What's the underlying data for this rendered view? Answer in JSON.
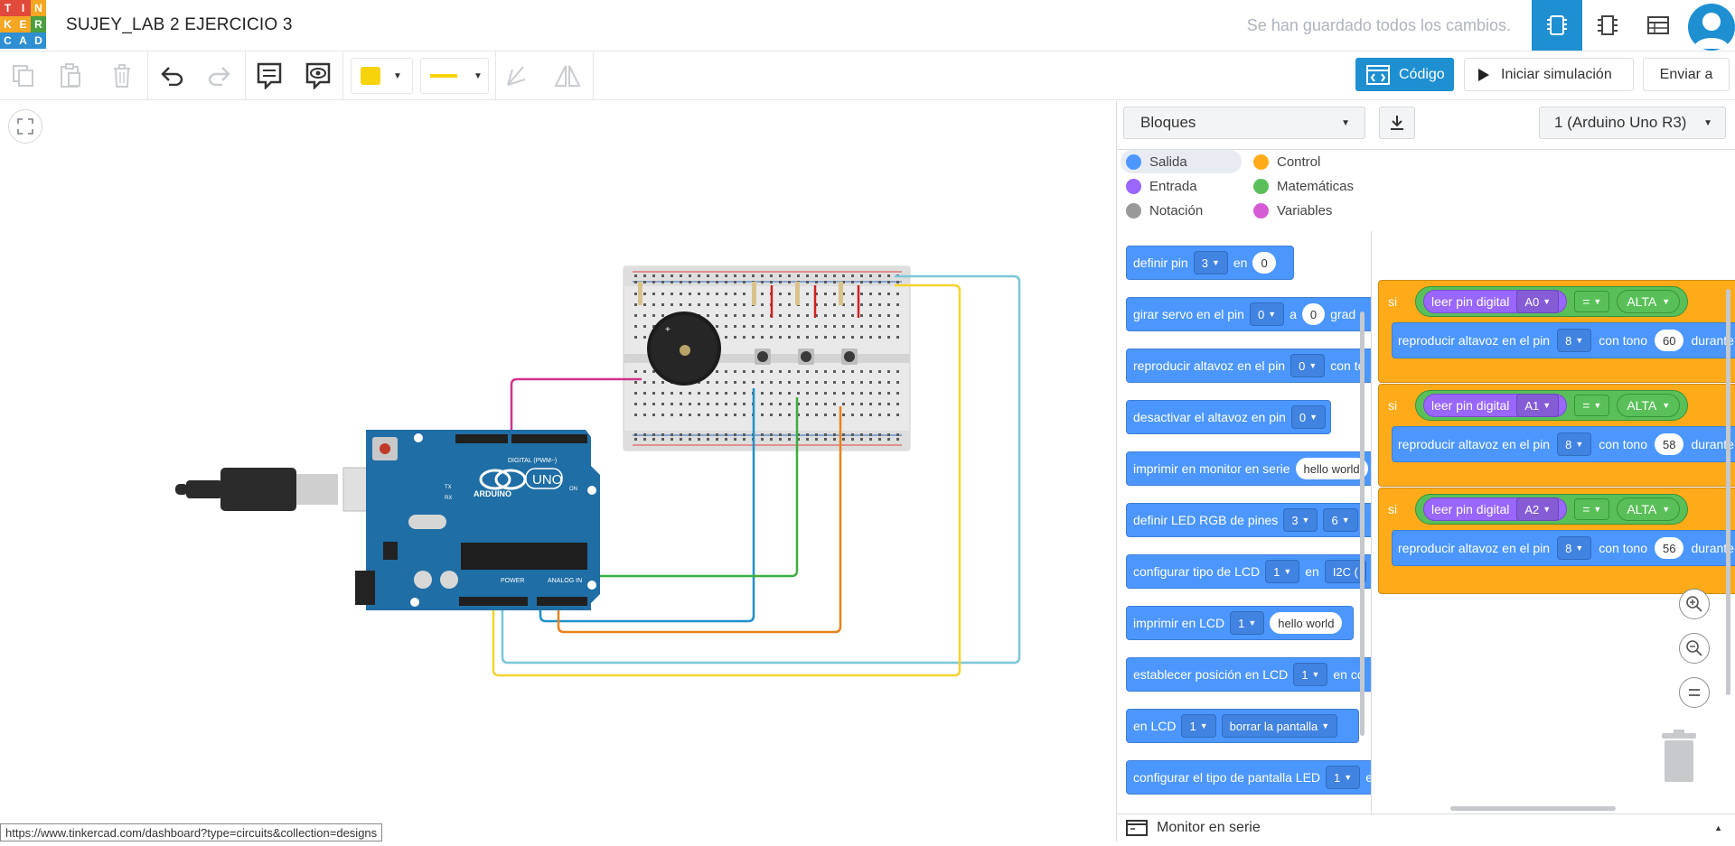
{
  "header": {
    "logo_letters": [
      "T",
      "I",
      "N",
      "K",
      "E",
      "R",
      "C",
      "A",
      "D"
    ],
    "logo_colors": [
      "#e1493b",
      "#e1493b",
      "#f5a623",
      "#f5a623",
      "#f5a623",
      "#4a9f3f",
      "#2e8fd2",
      "#2e8fd2",
      "#2e8fd2"
    ],
    "title": "SUJEY_LAB 2 EJERCICIO 3",
    "save_status": "Se han guardado todos los cambios."
  },
  "toolbar": {
    "code_label": "Código",
    "simulate_label": "Iniciar simulación",
    "send_label": "Enviar a",
    "fill_color": "#f7d40a",
    "line_color": "#f7d40a"
  },
  "status_url": "https://www.tinkercad.com/dashboard?type=circuits&collection=designs",
  "code_panel": {
    "mode": "Bloques",
    "board": "1 (Arduino Uno R3)",
    "categories": [
      {
        "label": "Salida",
        "color": "#4c97ff"
      },
      {
        "label": "Control",
        "color": "#ffab19"
      },
      {
        "label": "Entrada",
        "color": "#9966ff"
      },
      {
        "label": "Matemáticas",
        "color": "#59c059"
      },
      {
        "label": "Notación",
        "color": "#999999"
      },
      {
        "label": "Variables",
        "color": "#d65cd6"
      }
    ],
    "palette": {
      "b1": {
        "text": "definir pin",
        "v1": "3",
        "mid": "en",
        "v2": "0"
      },
      "b2": {
        "text": "girar servo en el pin",
        "v1": "0",
        "mid": "a",
        "v2": "0",
        "tail": "grad"
      },
      "b3": {
        "text": "reproducir altavoz en el pin",
        "v1": "0",
        "tail": "con to"
      },
      "b4": {
        "text": "desactivar el altavoz en pin",
        "v1": "0"
      },
      "b5": {
        "text": "imprimir en monitor en serie",
        "v1": "hello world"
      },
      "b6": {
        "text": "definir LED RGB de pines",
        "v1": "3",
        "v2": "6"
      },
      "b7": {
        "text": "configurar tipo de LCD",
        "v1": "1",
        "mid": "en",
        "v2": "I2C ("
      },
      "b8": {
        "text": "imprimir en LCD",
        "v1": "1",
        "v2": "hello world"
      },
      "b9": {
        "text": "establecer posición en LCD",
        "v1": "1",
        "tail": "en co"
      },
      "b10": {
        "text": "en LCD",
        "v1": "1",
        "v2": "borrar la pantalla"
      },
      "b11": {
        "text": "configurar el tipo de pantalla LED",
        "v1": "1",
        "tail": "e"
      }
    },
    "program": [
      {
        "si": "si",
        "read": "leer pin digital",
        "pin": "A0",
        "op": "=",
        "state": "ALTA",
        "action": "reproducir altavoz en el pin",
        "speaker_pin": "8",
        "tone_label": "con tono",
        "tone": "60",
        "during": "durante"
      },
      {
        "si": "si",
        "read": "leer pin digital",
        "pin": "A1",
        "op": "=",
        "state": "ALTA",
        "action": "reproducir altavoz en el pin",
        "speaker_pin": "8",
        "tone_label": "con tono",
        "tone": "58",
        "during": "durante"
      },
      {
        "si": "si",
        "read": "leer pin digital",
        "pin": "A2",
        "op": "=",
        "state": "ALTA",
        "action": "reproducir altavoz en el pin",
        "speaker_pin": "8",
        "tone_label": "con tono",
        "tone": "56",
        "during": "durante"
      }
    ],
    "serial_monitor": "Monitor en serie"
  },
  "circuit": {
    "board_label": "ARDUINO",
    "board_model": "UNO",
    "digital_label": "DIGITAL (PWM~)",
    "power_label": "POWER",
    "analog_label": "ANALOG IN",
    "on_label": "ON",
    "tx_label": "TX",
    "rx_label": "RX",
    "wire_colors": {
      "yellow": "#f6d32d",
      "cyan": "#7ac7d8",
      "magenta": "#d1328a",
      "blue": "#1e90c8",
      "green": "#3cae3f",
      "orange": "#e9821b"
    }
  }
}
